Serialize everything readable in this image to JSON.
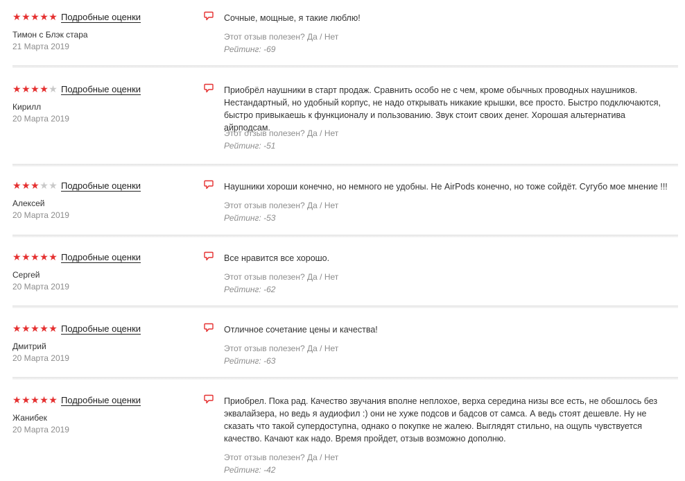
{
  "icons": {
    "star": "★",
    "comment": "comment-icon"
  },
  "colors": {
    "star_active": "#e53030",
    "star_inactive": "#c9c9c9",
    "comment_icon": "#e53030"
  },
  "reviews": [
    {
      "stars": 5,
      "details_label": "Подробные оценки",
      "author": "Тимон с Блэк стара",
      "date": "21 Марта 2019",
      "text": "Сочные, мощные, я такие люблю!",
      "helpful_q": "Этот отзыв полезен?",
      "yes": "Да",
      "sep": "/",
      "no": "Нет",
      "rating": "Рейтинг: -69"
    },
    {
      "stars": 4,
      "details_label": "Подробные оценки",
      "author": "Кирилл",
      "date": "20 Марта 2019",
      "text": "Приобрёл наушники в старт продаж. Сравнить особо не с чем, кроме обычных проводных наушников. Нестандартный, но удобный корпус, не надо открывать никакие крышки, все просто. Быстро подключаются, быстро привыкаешь к функционалу и пользованию. Звук стоит своих денег. Хорошая альтернатива айрподсам.",
      "helpful_q": "Этот отзыв полезен?",
      "yes": "Да",
      "sep": "/",
      "no": "Нет",
      "rating": "Рейтинг: -51"
    },
    {
      "stars": 3,
      "details_label": "Подробные оценки",
      "author": "Алексей",
      "date": "20 Марта 2019",
      "text": "Наушники хороши конечно, но немного не удобны. Не AirPods конечно, но тоже сойдёт. Сугубо мое мнение !!!",
      "helpful_q": "Этот отзыв полезен?",
      "yes": "Да",
      "sep": "/",
      "no": "Нет",
      "rating": "Рейтинг: -53"
    },
    {
      "stars": 5,
      "details_label": "Подробные оценки",
      "author": "Сергей",
      "date": "20 Марта 2019",
      "text": "Все нравится все хорошо.",
      "helpful_q": "Этот отзыв полезен?",
      "yes": "Да",
      "sep": "/",
      "no": "Нет",
      "rating": "Рейтинг: -62"
    },
    {
      "stars": 5,
      "details_label": "Подробные оценки",
      "author": "Дмитрий",
      "date": "20 Марта 2019",
      "text": "Отличное сочетание цены и качества!",
      "helpful_q": "Этот отзыв полезен?",
      "yes": "Да",
      "sep": "/",
      "no": "Нет",
      "rating": "Рейтинг: -63"
    },
    {
      "stars": 5,
      "details_label": "Подробные оценки",
      "author": "Жанибек",
      "date": "20 Марта 2019",
      "text": "Приобрел. Пока рад. Качество звучания вполне неплохое, верха середина низы все есть, не обошлось без эквалайзера, но ведь я аудиофил :) они не хуже подсов и бадсов от самса. А ведь стоят дешевле. Ну не сказать что такой супердоступна, однако о покупке не жалею. Выглядят стильно, на ощупь чувствуется качество. Качают как надо. Время пройдет, отзыв возможно дополню.",
      "helpful_q": "Этот отзыв полезен?",
      "yes": "Да",
      "sep": "/",
      "no": "Нет",
      "rating": "Рейтинг: -42"
    }
  ]
}
